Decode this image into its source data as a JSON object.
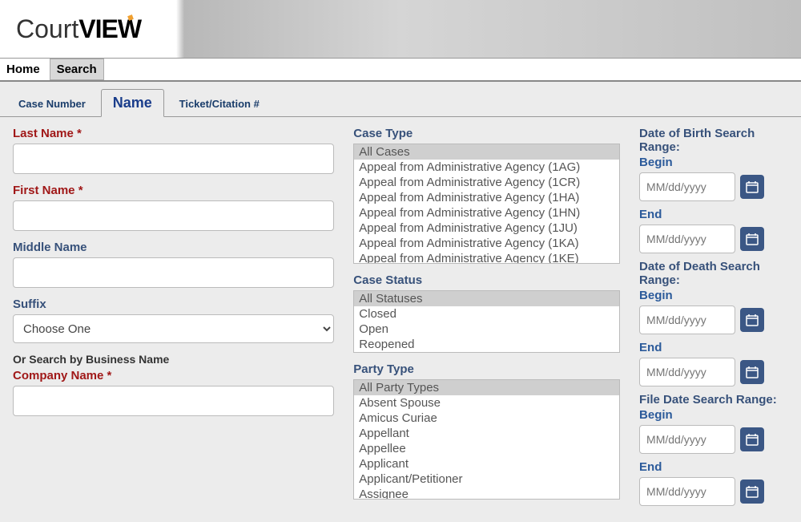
{
  "logo": {
    "part1": "Court",
    "part2": "VIEW"
  },
  "nav": {
    "home": "Home",
    "search": "Search"
  },
  "tabs": {
    "case_number": "Case Number",
    "name": "Name",
    "ticket": "Ticket/Citation #"
  },
  "left": {
    "last_name": "Last Name",
    "first_name": "First Name",
    "middle_name": "Middle Name",
    "suffix": "Suffix",
    "suffix_placeholder": "Choose One",
    "or_search": "Or Search by Business Name",
    "company_name": "Company Name"
  },
  "mid": {
    "case_type_label": "Case Type",
    "case_types": [
      "All Cases",
      "Appeal from Administrative Agency (1AG)",
      "Appeal from Administrative Agency (1CR)",
      "Appeal from Administrative Agency (1HA)",
      "Appeal from Administrative Agency (1HN)",
      "Appeal from Administrative Agency (1JU)",
      "Appeal from Administrative Agency (1KA)",
      "Appeal from Administrative Agency (1KE)"
    ],
    "case_status_label": "Case Status",
    "case_statuses": [
      "All Statuses",
      "Closed",
      "Open",
      "Reopened"
    ],
    "party_type_label": "Party Type",
    "party_types": [
      "All Party Types",
      "Absent Spouse",
      "Amicus Curiae",
      "Appellant",
      "Appellee",
      "Applicant",
      "Applicant/Petitioner",
      "Assignee"
    ]
  },
  "right": {
    "dob_label": "Date of Birth Search Range:",
    "dod_label": "Date of Death Search Range:",
    "file_label": "File Date Search Range:",
    "begin": "Begin",
    "end": "End",
    "placeholder": "MM/dd/yyyy"
  }
}
